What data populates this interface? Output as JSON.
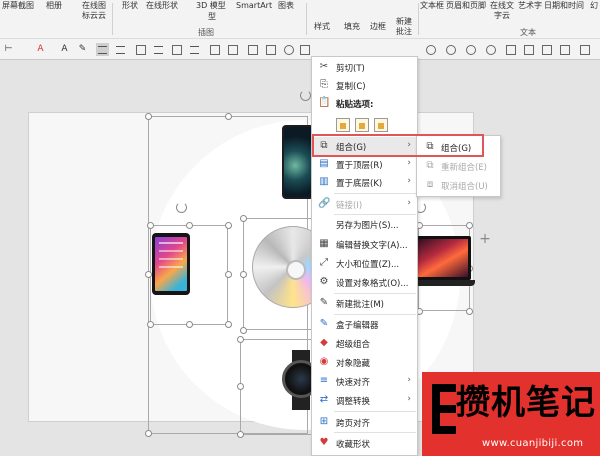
{
  "ribbon": {
    "top_labels": [
      "屏幕截图",
      "相册",
      "形状",
      "在线形状",
      "3D 模型",
      "SmartArt",
      "图表",
      "文本框",
      "页眉和页脚",
      "在线文字云",
      "艺术字",
      "日期和时间",
      "幻"
    ],
    "online_icons_label": "在线图标云云",
    "model_sub": "型",
    "insert_group": "插图",
    "text_group": "文本",
    "style_label": "样式",
    "fill_label": "填充",
    "border_label": "边框",
    "new_comment": "新建批注",
    "font_color_letter": "A",
    "font_size_letter": "A"
  },
  "context_menu": {
    "items": [
      {
        "icon": "✂",
        "label": "剪切(T)"
      },
      {
        "icon": "⎘",
        "label": "复制(C)"
      },
      {
        "icon": "📋",
        "label": "粘贴选项:"
      },
      {
        "icon": "⧉",
        "label": "组合(G)"
      },
      {
        "icon": "▤",
        "label": "置于顶层(R)"
      },
      {
        "icon": "▥",
        "label": "置于底层(K)"
      },
      {
        "icon": "🔗",
        "label": "链接(I)"
      },
      {
        "icon": "",
        "label": "另存为图片(S)..."
      },
      {
        "icon": "▦",
        "label": "编辑替换文字(A)..."
      },
      {
        "icon": "⤢",
        "label": "大小和位置(Z)..."
      },
      {
        "icon": "⚙",
        "label": "设置对象格式(O)..."
      },
      {
        "icon": "✎",
        "label": "新建批注(M)"
      },
      {
        "icon": "✎",
        "label": "盒子编辑器"
      },
      {
        "icon": "◆",
        "label": "超级组合"
      },
      {
        "icon": "◉",
        "label": "对象隐藏"
      },
      {
        "icon": "≡",
        "label": "快速对齐"
      },
      {
        "icon": "⇄",
        "label": "调整转换"
      },
      {
        "icon": "⊞",
        "label": "跨页对齐"
      },
      {
        "icon": "♥",
        "label": "收藏形状"
      }
    ]
  },
  "submenu": {
    "items": [
      {
        "icon": "⧉",
        "label": "组合(G)"
      },
      {
        "icon": "⧉",
        "label": "重新组合(E)"
      },
      {
        "icon": "⧈",
        "label": "取消组合(U)"
      }
    ]
  },
  "watermark": {
    "title": "攒机笔记",
    "url": "www.cuanjibiji.com"
  },
  "colors": {
    "highlight": "#e05656",
    "watermark_bg": "#e3312e",
    "menu_bg": "#ffffff",
    "ribbon_bg": "#f3f3f3"
  }
}
